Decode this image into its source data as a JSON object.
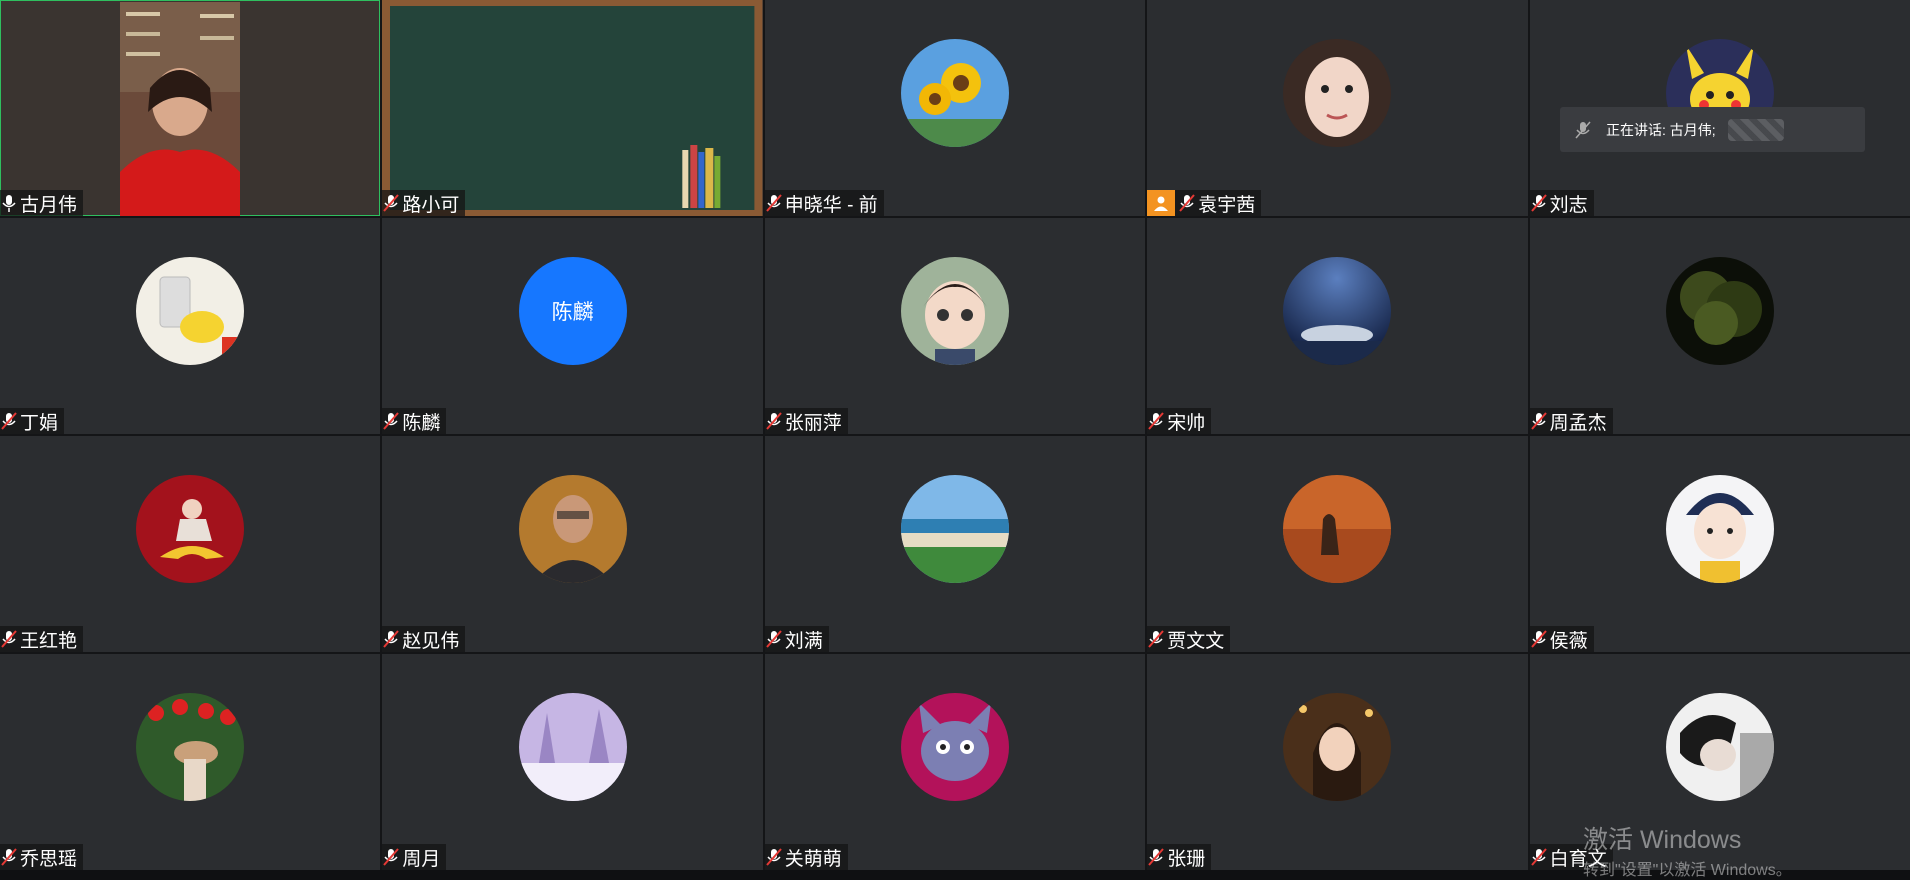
{
  "speaking": {
    "label": "正在讲话: 古月伟;"
  },
  "watermark": {
    "line1": "激活 Windows",
    "line2": "转到\"设置\"以激活 Windows。"
  },
  "colors": {
    "accent_blue": "#1677ff",
    "host_orange": "#f39321",
    "active_border": "#2fbf5f",
    "mic_red": "#e53935"
  },
  "participants": [
    {
      "name": "古月伟",
      "kind": "video-person"
    },
    {
      "name": "路小可",
      "kind": "video-chalkboard"
    },
    {
      "name": "申晓华 - 前",
      "kind": "avatar-sunflower"
    },
    {
      "name": "袁宇茜",
      "kind": "avatar-child-face",
      "host": true
    },
    {
      "name": "刘志",
      "kind": "avatar-pikachu"
    },
    {
      "name": "丁娟",
      "kind": "avatar-cartoon-yellow"
    },
    {
      "name": "陈麟",
      "kind": "avatar-text",
      "avatar_text": "陈麟"
    },
    {
      "name": "张丽萍",
      "kind": "avatar-doll"
    },
    {
      "name": "宋帅",
      "kind": "avatar-stadium-night"
    },
    {
      "name": "周孟杰",
      "kind": "avatar-tree-night"
    },
    {
      "name": "王红艳",
      "kind": "avatar-red-dancer"
    },
    {
      "name": "赵见伟",
      "kind": "avatar-man-portrait"
    },
    {
      "name": "刘满",
      "kind": "avatar-beach"
    },
    {
      "name": "贾文文",
      "kind": "avatar-sunset-sea"
    },
    {
      "name": "侯薇",
      "kind": "avatar-cartoon-girl"
    },
    {
      "name": "乔思瑶",
      "kind": "avatar-roses"
    },
    {
      "name": "周月",
      "kind": "avatar-snow-trees"
    },
    {
      "name": "关萌萌",
      "kind": "avatar-cartoon-cat"
    },
    {
      "name": "张珊",
      "kind": "avatar-woman-smile"
    },
    {
      "name": "白育文",
      "kind": "avatar-bw-portrait"
    }
  ]
}
